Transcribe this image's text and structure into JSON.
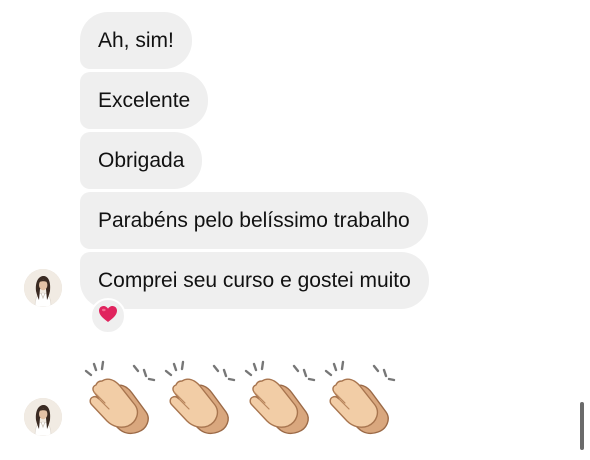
{
  "conversation": {
    "messages": [
      {
        "text": "Ah, sim!"
      },
      {
        "text": "Excelente"
      },
      {
        "text": "Obrigada"
      },
      {
        "text": "Parabéns pelo belíssimo trabalho"
      },
      {
        "text": "Comprei seu curso e gostei muito"
      }
    ],
    "reaction": {
      "icon": "red-heart-icon",
      "color": "#e0245e"
    },
    "emoji_message": {
      "icons": [
        "clapping-hands-icon",
        "clapping-hands-icon",
        "clapping-hands-icon",
        "clapping-hands-icon"
      ]
    }
  },
  "colors": {
    "bubble_background": "#efefef",
    "text": "#111111",
    "background": "#ffffff"
  }
}
